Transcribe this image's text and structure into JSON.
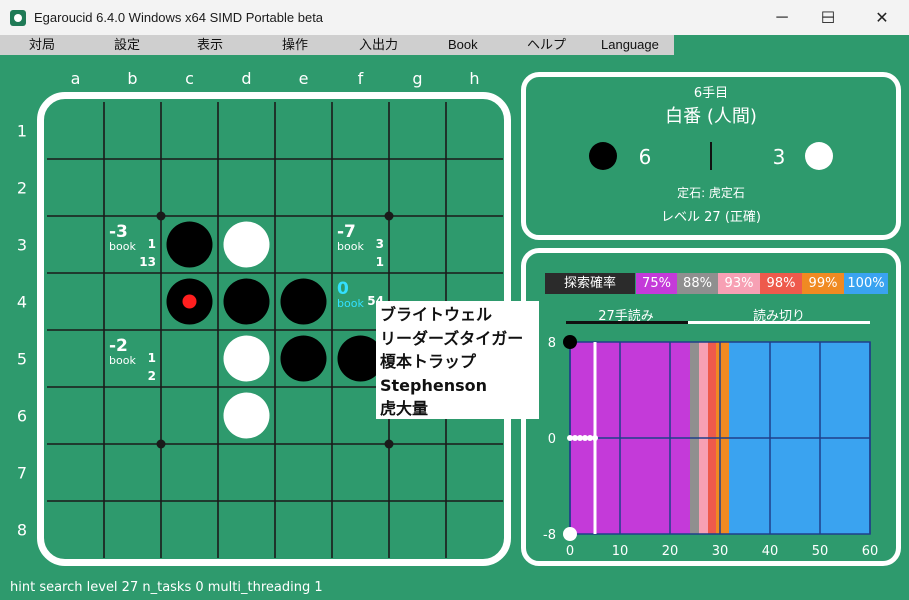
{
  "window": {
    "title": "Egaroucid 6.4.0 Windows x64 SIMD Portable beta",
    "minimize": "─",
    "maximize": "☐",
    "close": "✕"
  },
  "menu": [
    {
      "label": "対局"
    },
    {
      "label": "設定"
    },
    {
      "label": "表示"
    },
    {
      "label": "操作"
    },
    {
      "label": "入出力"
    },
    {
      "label": "Book"
    },
    {
      "label": "ヘルプ"
    },
    {
      "label": "Language"
    }
  ],
  "board": {
    "columns": [
      "a",
      "b",
      "c",
      "d",
      "e",
      "f",
      "g",
      "h"
    ],
    "rows": [
      "1",
      "2",
      "3",
      "4",
      "5",
      "6",
      "7",
      "8"
    ],
    "black": [
      "c3",
      "c4",
      "d4",
      "e4",
      "e5",
      "f5"
    ],
    "white": [
      "d3",
      "d5",
      "d6"
    ],
    "last_move": "c4",
    "hints": [
      {
        "cell": "b3",
        "value": "-3",
        "tag": "book",
        "n1": "1",
        "n2": "13",
        "color": "#ffffff"
      },
      {
        "cell": "f3",
        "value": "-7",
        "tag": "book",
        "n1": "3",
        "n2": "1",
        "color": "#ffffff"
      },
      {
        "cell": "f4",
        "value": "0",
        "tag": "book",
        "n1": "54",
        "n2": "",
        "color": "#33e0ff"
      },
      {
        "cell": "b5",
        "value": "-2",
        "tag": "book",
        "n1": "1",
        "n2": "2",
        "color": "#ffffff"
      }
    ]
  },
  "info": {
    "move_number": "6手目",
    "turn": "白番 (人間)",
    "black_count": "6",
    "white_count": "3",
    "opening": "定石: 虎定石",
    "level": "レベル 27 (正確)"
  },
  "search_legend": {
    "label": "探索確率",
    "items": [
      {
        "label": "75%",
        "color": "#c43ad9"
      },
      {
        "label": "88%",
        "color": "#8f8f8f"
      },
      {
        "label": "93%",
        "color": "#f7a0b4"
      },
      {
        "label": "98%",
        "color": "#ee5a4c"
      },
      {
        "label": "99%",
        "color": "#f08a22"
      },
      {
        "label": "100%",
        "color": "#3aa3f0"
      }
    ]
  },
  "graph_modes": {
    "left": "27手読み",
    "right": "読み切り"
  },
  "chart_data": {
    "type": "line",
    "x_ticks": [
      "0",
      "10",
      "20",
      "30",
      "40",
      "50",
      "60"
    ],
    "y_ticks": [
      "8",
      "0",
      "-8"
    ],
    "xlim": [
      0,
      60
    ],
    "ylim": [
      -8,
      8
    ],
    "series": [
      {
        "values": [
          0,
          0,
          0,
          0,
          0,
          0
        ]
      }
    ],
    "current_move": 5
  },
  "opening_popup": [
    "ブライトウェル",
    "リーダーズタイガー",
    "榎本トラップ",
    "Stephenson",
    "虎大量"
  ],
  "status_bar": "hint search level 27 n_tasks 0 multi_threading 1"
}
